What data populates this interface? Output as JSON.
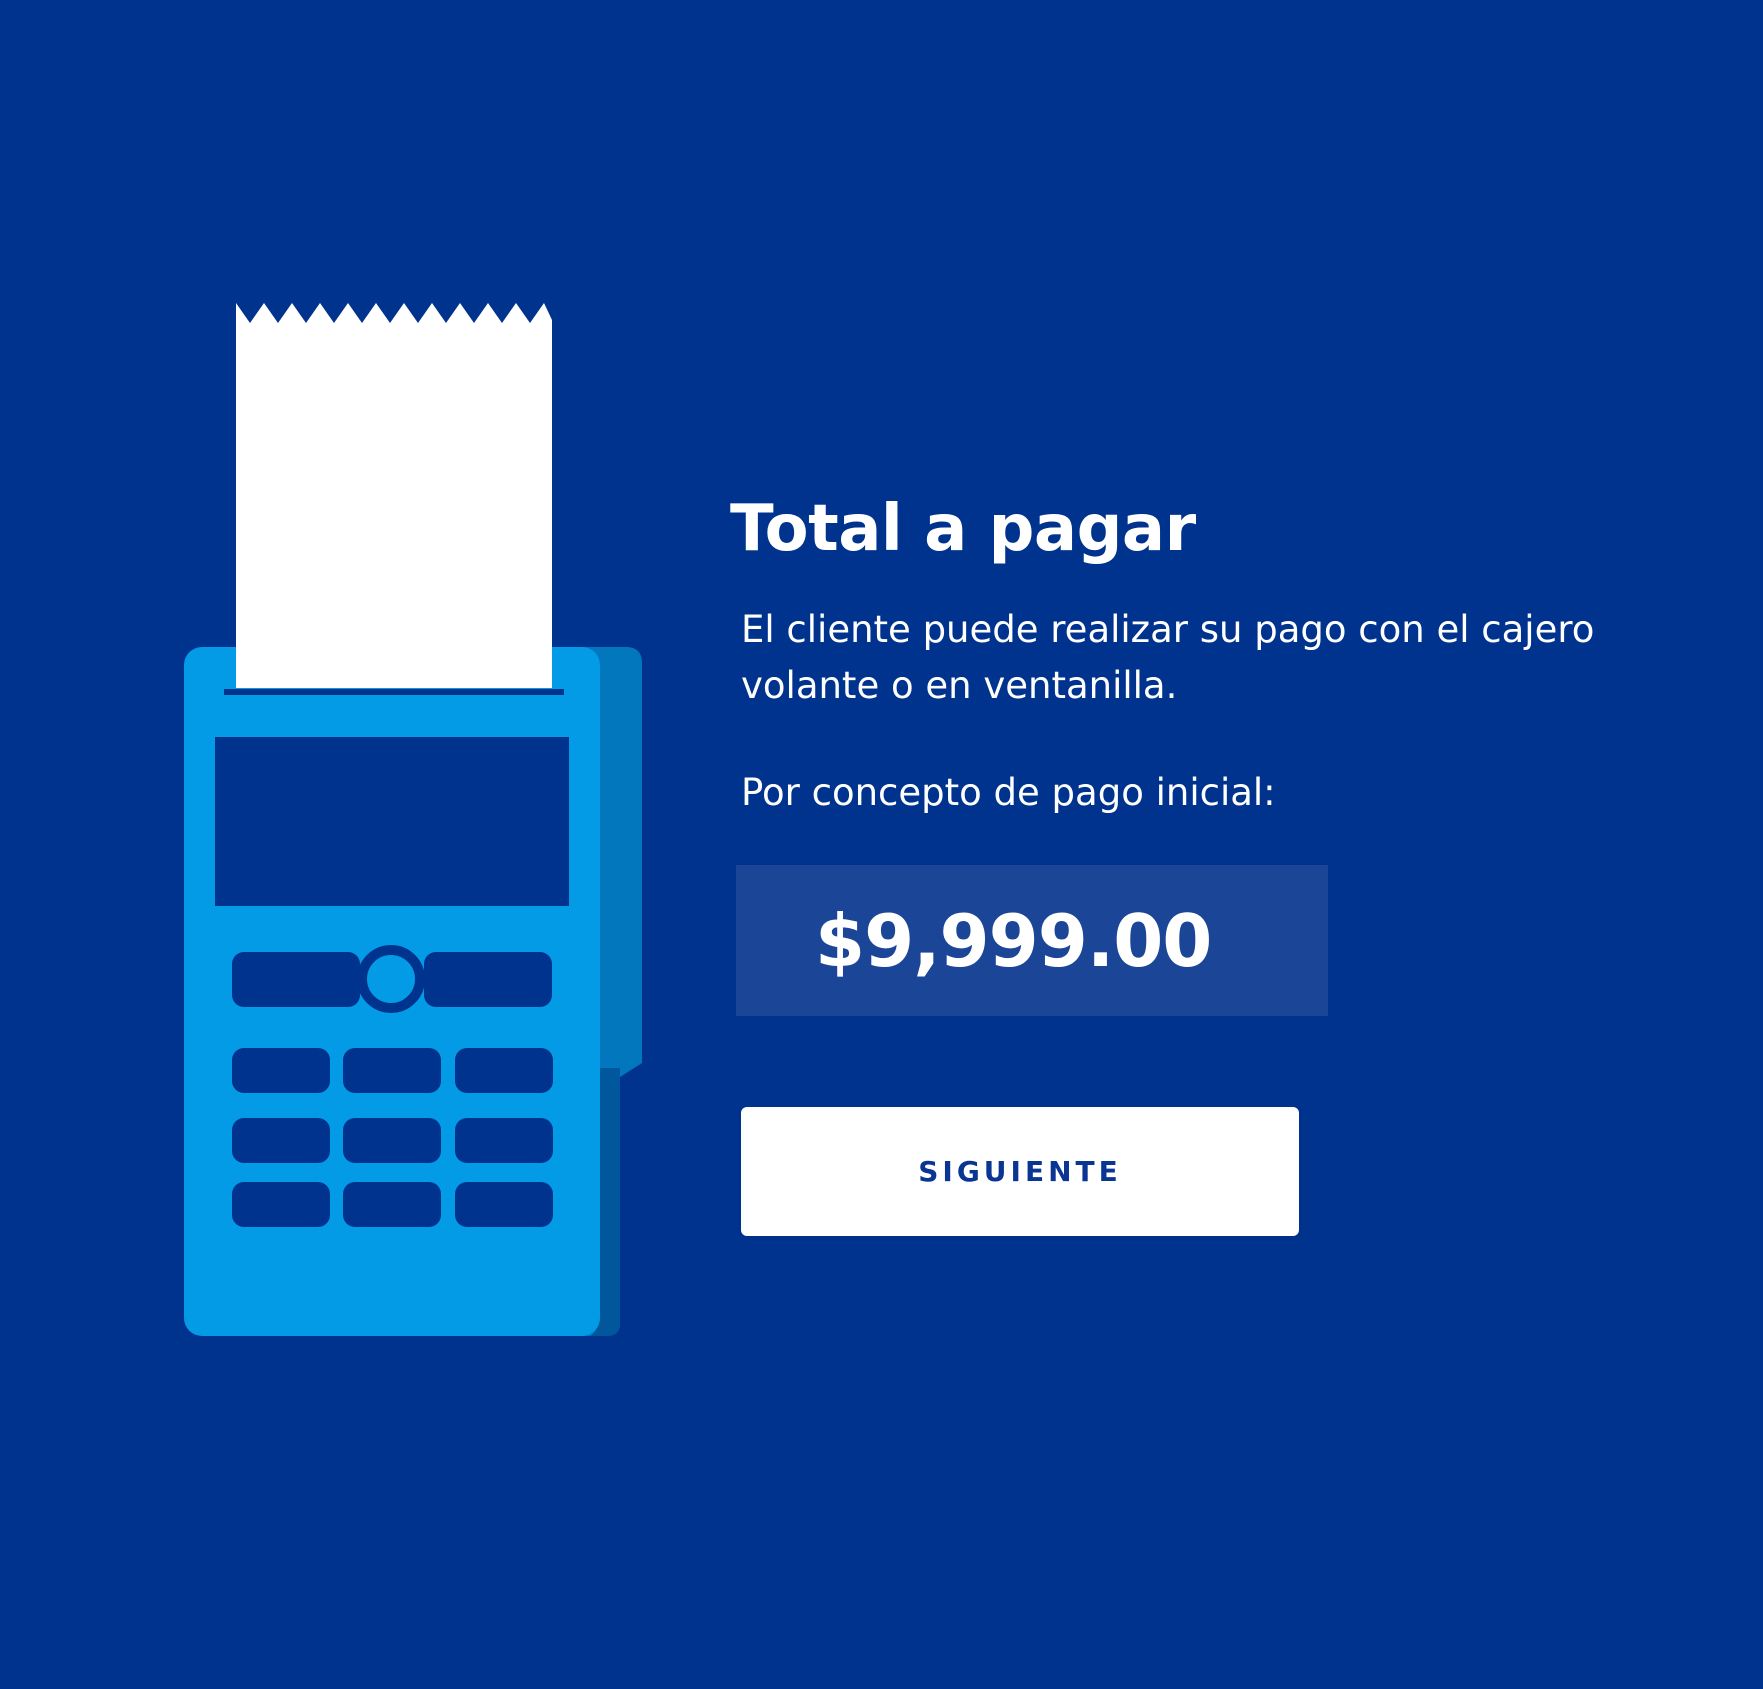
{
  "screen": {
    "title": "Total a pagar",
    "description": "El cliente puede realizar su pago con el cajero volante o en ventanilla.",
    "concept_label": "Por concepto de pago inicial:",
    "amount": "$9,999.00",
    "next_button_label": "SIGUIENTE"
  },
  "illustration": {
    "icon_name": "payment-terminal-icon",
    "receipt_icon_name": "receipt-paper-icon",
    "screen_icon_name": "terminal-screen-icon",
    "keypad_icon_name": "keypad-icon",
    "colors": {
      "background": "#00338e",
      "device_front": "#039be5",
      "device_side": "#0277bd",
      "device_dark_side": "#01579b",
      "display": "#00338e",
      "paper": "#ffffff",
      "amount_box": "#1b4698",
      "button_text": "#0b3593"
    }
  }
}
